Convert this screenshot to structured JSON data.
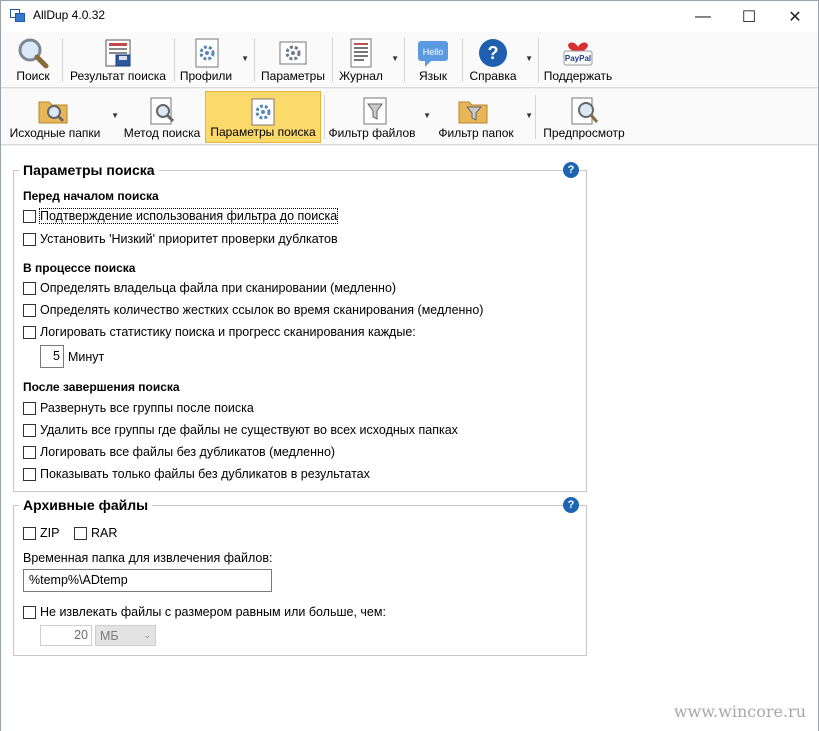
{
  "window": {
    "title": "AllDup 4.0.32"
  },
  "toolbar1": {
    "items": [
      {
        "label": "Поиск",
        "icon": "magnifier-icon"
      },
      {
        "label": "Результат поиска",
        "icon": "results-save-icon"
      },
      {
        "label": "Профили",
        "icon": "profiles-gear-icon"
      },
      {
        "label": "Параметры",
        "icon": "settings-gear-icon"
      },
      {
        "label": "Журнал",
        "icon": "log-document-icon"
      },
      {
        "label": "Язык",
        "icon": "hello-bubble-icon",
        "icon_text": "Hello"
      },
      {
        "label": "Справка",
        "icon": "help-icon"
      },
      {
        "label": "Поддержать",
        "icon": "paypal-heart-icon",
        "icon_text": "PayPal"
      }
    ]
  },
  "toolbar2": {
    "items": [
      {
        "label": "Исходные папки",
        "icon": "folder-search-icon"
      },
      {
        "label": "Метод поиска",
        "icon": "document-search-icon"
      },
      {
        "label": "Параметры поиска",
        "icon": "settings-document-icon",
        "active": true
      },
      {
        "label": "Фильтр файлов",
        "icon": "file-filter-icon"
      },
      {
        "label": "Фильтр папок",
        "icon": "folder-filter-icon"
      },
      {
        "label": "Предпросмотр",
        "icon": "preview-icon"
      }
    ]
  },
  "search_params": {
    "title": "Параметры поиска",
    "before": {
      "header": "Перед началом поиска",
      "options": [
        {
          "label": "Подтверждение использования фильтра до поиска",
          "checked": false
        },
        {
          "label": "Установить 'Низкий' приоритет проверки дублкатов",
          "checked": false
        }
      ]
    },
    "during": {
      "header": "В процессе поиска",
      "options": [
        {
          "label": "Определять владельца файла при сканировании (медленно)",
          "checked": false
        },
        {
          "label": "Определять количество жестких ссылок во время сканирования (медленно)",
          "checked": false
        },
        {
          "label": "Логировать статистику поиска и прогресс сканирования каждые:",
          "checked": false
        }
      ],
      "interval_value": "5",
      "interval_unit": "Минут"
    },
    "after": {
      "header": "После завершения поиска",
      "options": [
        {
          "label": "Развернуть все группы после поиска",
          "checked": false
        },
        {
          "label": "Удалить все группы где файлы не существуют во всех исходных папках",
          "checked": false
        },
        {
          "label": "Логировать все файлы без дубликатов (медленно)",
          "checked": false
        },
        {
          "label": "Показывать только файлы без дубликатов в результатах",
          "checked": false
        }
      ]
    }
  },
  "archive": {
    "title": "Архивные файлы",
    "zip_label": "ZIP",
    "rar_label": "RAR",
    "temp_folder_label": "Временная папка для извлечения файлов:",
    "temp_folder_value": "%temp%\\ADtemp",
    "skip_label": "Не извлекать файлы с размером равным или больше, чем:",
    "size_value": "20",
    "size_unit": "МБ"
  },
  "help_glyph": "?",
  "watermark": "www.wincore.ru"
}
